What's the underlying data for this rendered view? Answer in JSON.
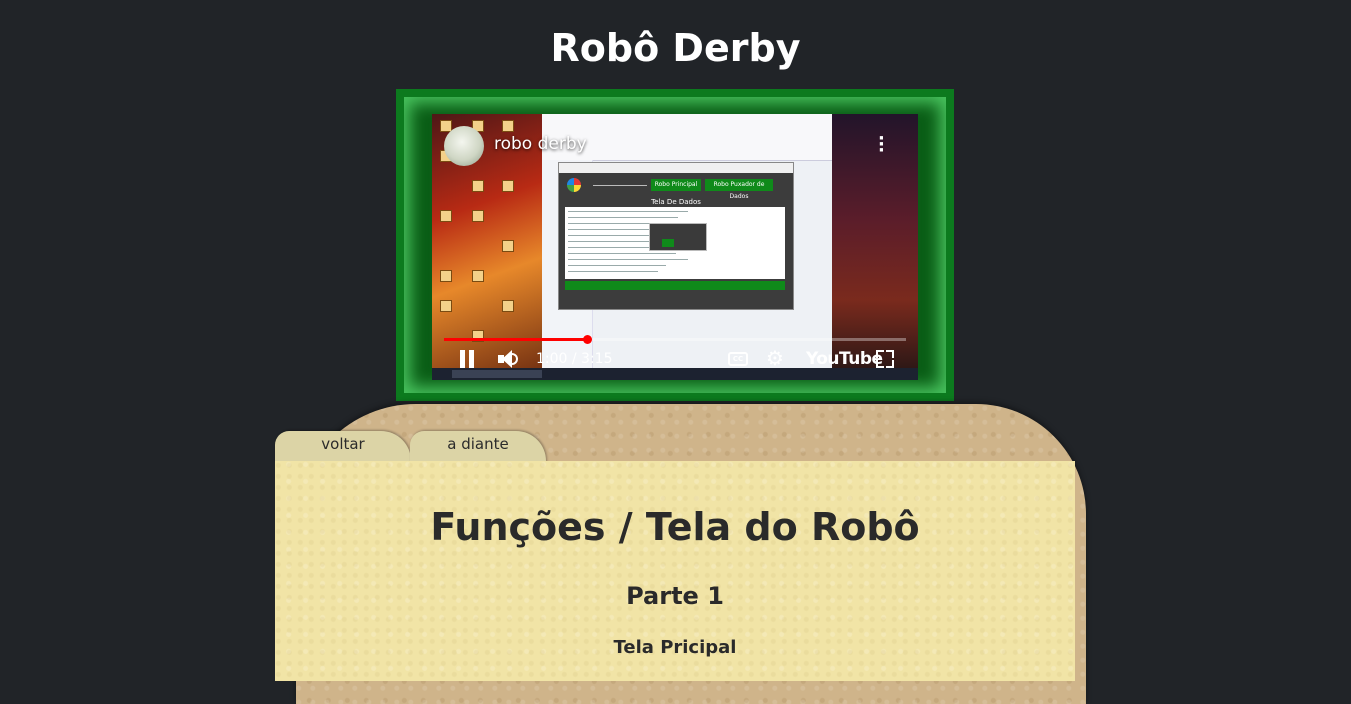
{
  "page": {
    "title": "Robô Derby"
  },
  "video": {
    "channel_name": "robo derby",
    "time": "1:00 / 3:15",
    "progress_fraction": 0.31,
    "brand": "YouTube",
    "cc_label": "CC",
    "app_tabs": [
      "Robo Principal",
      "Robo Puxador de Dados"
    ],
    "app_heading": "Tela De Dados",
    "frame_color": "#0c7a1e"
  },
  "folder": {
    "tabs": [
      {
        "label": "voltar"
      },
      {
        "label": "a diante"
      }
    ],
    "section_title": "Funções / Tela do Robô",
    "part_title": "Parte 1",
    "screen_title": "Tela Pricipal"
  }
}
